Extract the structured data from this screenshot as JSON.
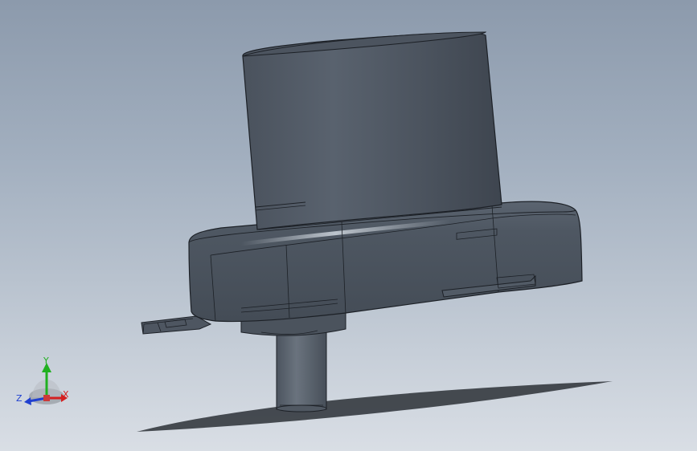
{
  "viewport": {
    "background_top": "#8c9aac",
    "background_bottom": "#d9dee5"
  },
  "model": {
    "body_color": "#4f5864",
    "edge_color": "#1c2026",
    "highlight_color": "#c9d0d8"
  },
  "triad": {
    "x_label": "X",
    "y_label": "Y",
    "z_label": "Z",
    "x_color": "#d42020",
    "y_color": "#20b020",
    "z_color": "#2040d0"
  }
}
